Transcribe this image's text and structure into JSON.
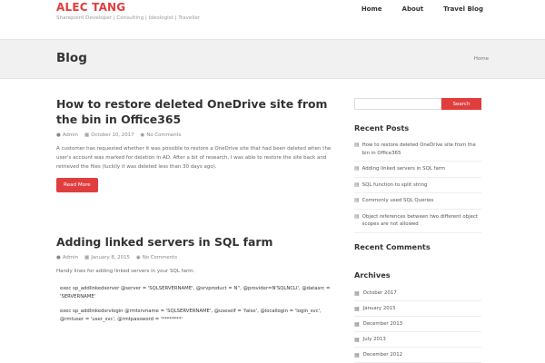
{
  "header": {
    "brand_title": "ALEC TANG",
    "tagline": "Sharepoint Developer | Consulting | Ideologist | Traveller",
    "nav": [
      "Home",
      "About",
      "Travel Blog"
    ]
  },
  "title_band": {
    "title": "Blog",
    "breadcrumb": "Home"
  },
  "posts": [
    {
      "title": "How to restore deleted OneDrive site from the bin in Office365",
      "author": "Admin",
      "date": "October 10, 2017",
      "comments": "No Comments",
      "excerpt": "A customer has requested whether it was possible to restore a OneDrive site that had been deleted when the user's account was marked for deletion in AD. After a bit of research, I was able to restore the site back and retrieved the files (luckily it was deleted less than 30 days ago).",
      "read_more": "Read More"
    },
    {
      "title": "Adding linked servers in SQL farm",
      "author": "Admin",
      "date": "January 8, 2015",
      "comments": "No Comments",
      "intro": "Handy lines for adding linked servers in your SQL farm:",
      "code": [
        "exec sp_addlinkedserver @server = 'SQLSERVERNAME', @srvproduct = N'', @provider=N'SQLNCLI', @datasrc =",
        "'SERVERNAME'",
        "exec sp_addlinkedsrvlogin @rmtsrvname = 'SQLSERVERNAME', @useself = 'false', @locallogin = 'login_svc',",
        "@rmtuser = 'user_svc', @rmtpassword = '********'"
      ]
    }
  ],
  "sidebar": {
    "search_button": "Search",
    "search_placeholder": "",
    "recent_posts_title": "Recent Posts",
    "recent_posts": [
      "How to restore deleted OneDrive site from the bin in Office365",
      "Adding linked servers in SQL farm",
      "SQL function to split string",
      "Commonly used SQL Queries",
      "Object references between two different object scopes are not allowed"
    ],
    "recent_comments_title": "Recent Comments",
    "archives_title": "Archives",
    "archives": [
      "October 2017",
      "January 2015",
      "December 2013",
      "July 2013",
      "December 2012"
    ]
  },
  "colors": {
    "accent": "#e03e3e",
    "band_bg": "#f1f1f1"
  },
  "icons": {
    "author": "user-icon",
    "date": "calendar-icon",
    "comments": "comment-icon",
    "recent_post": "document-icon",
    "archive": "calendar-icon"
  }
}
